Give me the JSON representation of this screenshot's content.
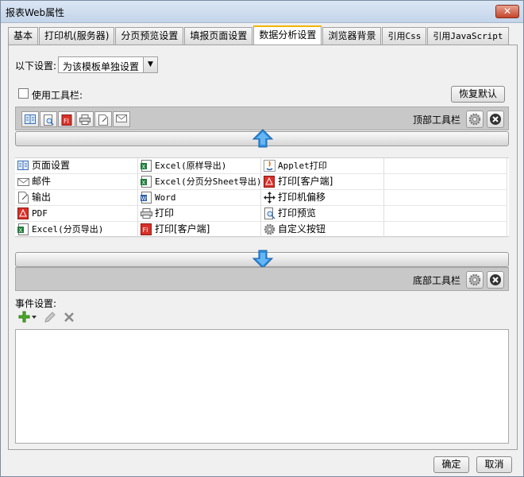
{
  "window": {
    "title": "报表Web属性",
    "close_label": "✕"
  },
  "tabs": [
    {
      "label": "基本",
      "active": false
    },
    {
      "label": "打印机(服务器)",
      "active": false
    },
    {
      "label": "分页预览设置",
      "active": false
    },
    {
      "label": "填报页面设置",
      "active": false
    },
    {
      "label": "数据分析设置",
      "active": true
    },
    {
      "label": "浏览器背景",
      "active": false
    },
    {
      "label": "引用Css",
      "active": false
    },
    {
      "label": "引用JavaScript",
      "active": false
    }
  ],
  "settings": {
    "label": "以下设置:",
    "selected": "为该模板单独设置"
  },
  "toolbar_toggle": {
    "label": "使用工具栏:",
    "checked": false
  },
  "restore_button": "恢复默认",
  "top_toolbar": {
    "label": "顶部工具栏",
    "icons": [
      "page-setup-icon",
      "preview-icon",
      "pdf-print-icon",
      "printer-icon",
      "export-icon",
      "email-icon"
    ]
  },
  "bottom_toolbar": {
    "label": "底部工具栏"
  },
  "available_buttons": [
    [
      {
        "label": "页面设置",
        "icon": "page-setup-icon"
      },
      {
        "label": "Excel(原样导出)",
        "icon": "excel-icon"
      },
      {
        "label": "Applet打印",
        "icon": "java-icon"
      }
    ],
    [
      {
        "label": "邮件",
        "icon": "email-icon"
      },
      {
        "label": "Excel(分页分Sheet导出)",
        "icon": "excel-icon"
      },
      {
        "label": "打印[客户端]",
        "icon": "pdf-icon"
      }
    ],
    [
      {
        "label": "输出",
        "icon": "export-icon"
      },
      {
        "label": "Word",
        "icon": "word-icon"
      },
      {
        "label": "打印机偏移",
        "icon": "move-icon"
      }
    ],
    [
      {
        "label": "PDF",
        "icon": "pdf-icon"
      },
      {
        "label": "打印",
        "icon": "printer-icon"
      },
      {
        "label": "打印预览",
        "icon": "preview-icon"
      }
    ],
    [
      {
        "label": "Excel(分页导出)",
        "icon": "excel-icon"
      },
      {
        "label": "打印[客户端]",
        "icon": "flash-print-icon"
      },
      {
        "label": "自定义按钮",
        "icon": "gear-icon"
      }
    ]
  ],
  "events": {
    "label": "事件设置:"
  },
  "footer": {
    "ok": "确定",
    "cancel": "取消"
  },
  "colors": {
    "accent_tab": "#f4b400",
    "arrow_blue": "#2b8fe0",
    "toolbar_band": "#c8c8c8"
  }
}
